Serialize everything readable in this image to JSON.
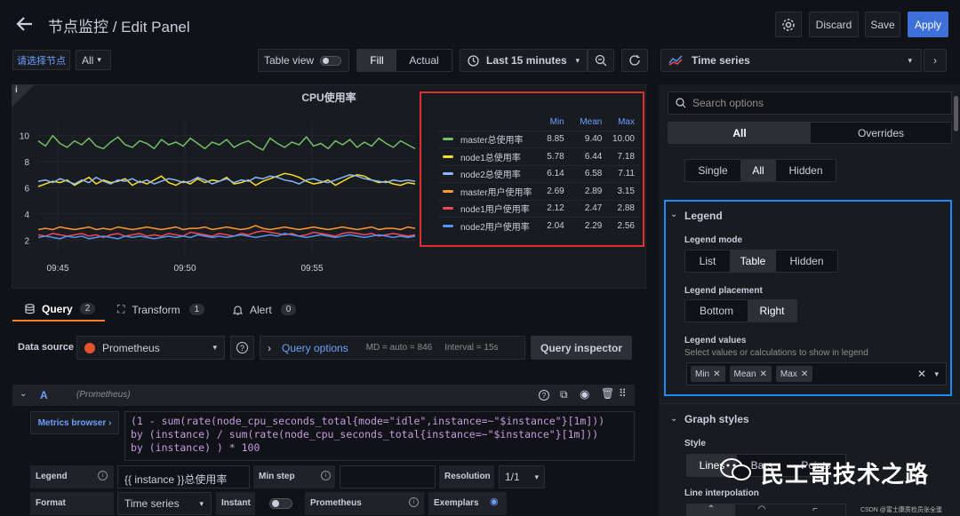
{
  "header": {
    "title": "节点监控 / Edit Panel",
    "discard": "Discard",
    "save": "Save",
    "apply": "Apply"
  },
  "toolbar": {
    "node_select": "请选择节点",
    "all": "All",
    "table_view": "Table view",
    "fill": "Fill",
    "actual": "Actual",
    "time_range": "Last 15 minutes",
    "viz": "Time series"
  },
  "chart_data": {
    "type": "line",
    "title": "CPU使用率",
    "x": [
      "09:45",
      "09:50",
      "09:55"
    ],
    "ylim": [
      1,
      11
    ],
    "yticks": [
      2,
      4,
      6,
      8,
      10
    ],
    "series": [
      {
        "name": "master总使用率",
        "color": "#73bf69",
        "min": "8.85",
        "mean": "9.40",
        "max": "10.00",
        "values": [
          9.6,
          9.2,
          10.0,
          9.4,
          9.1,
          9.6,
          9.3,
          9.8,
          9.2,
          9.0,
          9.5,
          9.9,
          9.3,
          9.1,
          9.6,
          9.4,
          9.0,
          9.7,
          9.3,
          9.5,
          9.2,
          9.8,
          9.4,
          9.0,
          9.5,
          9.3,
          9.7,
          9.1,
          9.4,
          9.6,
          9.2,
          8.9,
          9.8,
          9.4,
          9.1,
          9.5,
          9.3,
          9.9,
          9.2,
          9.4,
          9.0,
          9.6,
          9.3,
          9.7,
          9.1,
          9.5,
          9.2,
          9.8,
          9.4,
          9.1,
          9.6,
          9.3,
          9.0
        ]
      },
      {
        "name": "node1总使用率",
        "color": "#fade2a",
        "min": "5.78",
        "mean": "6.44",
        "max": "7.18",
        "values": [
          6.1,
          6.3,
          6.5,
          6.4,
          6.6,
          6.2,
          6.5,
          6.8,
          6.3,
          6.6,
          6.4,
          6.5,
          6.7,
          6.2,
          6.5,
          6.3,
          6.6,
          6.9,
          6.4,
          6.2,
          6.5,
          6.3,
          6.7,
          6.4,
          6.6,
          6.5,
          6.8,
          6.3,
          6.4,
          6.6,
          6.2,
          6.5,
          6.7,
          6.9,
          7.1,
          7.0,
          6.8,
          6.5,
          6.3,
          6.4,
          6.6,
          6.2,
          6.5,
          6.8,
          7.0,
          6.9,
          6.6,
          6.4,
          6.5,
          6.3,
          6.2,
          6.4,
          6.3
        ]
      },
      {
        "name": "node2总使用率",
        "color": "#8ab8ff",
        "min": "6.14",
        "mean": "6.58",
        "max": "7.11",
        "values": [
          6.5,
          6.6,
          6.4,
          6.7,
          6.5,
          6.3,
          6.6,
          6.4,
          6.8,
          6.5,
          6.3,
          6.6,
          6.5,
          6.7,
          6.4,
          6.6,
          6.3,
          6.5,
          6.7,
          6.6,
          6.4,
          6.5,
          6.8,
          6.6,
          6.3,
          6.5,
          6.7,
          6.4,
          6.6,
          6.5,
          6.8,
          6.7,
          6.9,
          6.8,
          6.6,
          6.5,
          6.3,
          6.6,
          6.7,
          6.5,
          6.4,
          6.6,
          6.8,
          7.0,
          6.9,
          6.7,
          6.6,
          6.5,
          6.4,
          6.6,
          6.5,
          6.6,
          6.5
        ]
      },
      {
        "name": "master用户使用率",
        "color": "#ff9830",
        "min": "2.69",
        "mean": "2.89",
        "max": "3.15",
        "values": [
          2.8,
          2.9,
          2.8,
          3.0,
          2.9,
          2.8,
          2.9,
          3.0,
          2.8,
          2.9,
          2.8,
          3.0,
          2.9,
          2.8,
          2.9,
          3.0,
          2.9,
          2.8,
          2.9,
          3.0,
          2.8,
          2.9,
          2.9,
          3.0,
          2.8,
          2.9,
          3.0,
          2.9,
          2.8,
          2.9,
          3.1,
          2.9,
          2.8,
          2.9,
          3.0,
          2.9,
          2.8,
          2.9,
          3.0,
          2.9,
          2.8,
          2.9,
          3.0,
          2.9,
          2.8,
          2.9,
          3.0,
          2.8,
          2.9,
          2.9,
          2.8,
          3.0,
          2.9
        ]
      },
      {
        "name": "node1用户使用率",
        "color": "#f2495c",
        "min": "2.12",
        "mean": "2.47",
        "max": "2.88",
        "values": [
          2.4,
          2.3,
          2.5,
          2.4,
          2.3,
          2.4,
          2.5,
          2.3,
          2.4,
          2.2,
          2.4,
          2.5,
          2.3,
          2.4,
          2.5,
          2.3,
          2.4,
          2.3,
          2.5,
          2.4,
          2.3,
          2.6,
          2.5,
          2.4,
          2.3,
          2.5,
          2.4,
          2.3,
          2.5,
          2.4,
          2.6,
          2.7,
          2.6,
          2.5,
          2.4,
          2.5,
          2.3,
          2.4,
          2.6,
          2.5,
          2.4,
          2.3,
          2.5,
          2.6,
          2.5,
          2.4,
          2.5,
          2.3,
          2.4,
          2.5,
          2.4,
          2.3,
          2.4
        ]
      },
      {
        "name": "node2用户使用率",
        "color": "#5794f2",
        "min": "2.04",
        "mean": "2.29",
        "max": "2.56",
        "values": [
          2.2,
          2.3,
          2.2,
          2.1,
          2.3,
          2.2,
          2.3,
          2.1,
          2.2,
          2.3,
          2.2,
          2.1,
          2.3,
          2.2,
          2.3,
          2.2,
          2.1,
          2.2,
          2.3,
          2.2,
          2.3,
          2.2,
          2.4,
          2.3,
          2.2,
          2.3,
          2.2,
          2.3,
          2.4,
          2.3,
          2.2,
          2.3,
          2.4,
          2.3,
          2.5,
          2.4,
          2.3,
          2.2,
          2.3,
          2.4,
          2.3,
          2.2,
          2.3,
          2.4,
          2.3,
          2.2,
          2.3,
          2.4,
          2.3,
          2.2,
          2.3,
          2.2,
          2.3
        ]
      }
    ],
    "legend": {
      "headers": [
        "Min",
        "Mean",
        "Max"
      ],
      "placement": "right"
    }
  },
  "tabs": [
    {
      "label": "Query",
      "count": "2"
    },
    {
      "label": "Transform",
      "count": "1"
    },
    {
      "label": "Alert",
      "count": "0"
    }
  ],
  "query": {
    "datasource_label": "Data source",
    "datasource": "Prometheus",
    "options": "Query options",
    "md": "MD = auto = 846",
    "interval": "Interval = 15s",
    "inspector": "Query inspector",
    "row_letter": "A",
    "row_ds": "(Prometheus)",
    "metrics_browser": "Metrics browser ›",
    "expr_line1": "(1 - sum(rate(node_cpu_seconds_total{mode=\"idle\",instance=~\"$instance\"}[1m]))",
    "expr_line2": "by (instance) / sum(rate(node_cpu_seconds_total{instance=~\"$instance\"}[1m]))",
    "expr_line3": "by (instance) ) * 100",
    "legend_label": "Legend",
    "legend_value": "{{ instance }}总使用率",
    "min_step": "Min step",
    "resolution": "Resolution",
    "resolution_value": "1/1",
    "format": "Format",
    "format_value": "Time series",
    "instant": "Instant",
    "prom": "Prometheus",
    "exemplars": "Exemplars"
  },
  "options": {
    "search_placeholder": "Search options",
    "all": "All",
    "overrides": "Overrides",
    "single": "Single",
    "all2": "All",
    "hidden": "Hidden",
    "legend_section": "Legend",
    "legend_mode": "Legend mode",
    "mode_list": "List",
    "mode_table": "Table",
    "mode_hidden": "Hidden",
    "legend_placement": "Legend placement",
    "bottom": "Bottom",
    "right": "Right",
    "legend_values": "Legend values",
    "legend_values_desc": "Select values or calculations to show in legend",
    "chip_min": "Min",
    "chip_mean": "Mean",
    "chip_max": "Max",
    "graph_styles": "Graph styles",
    "style": "Style",
    "style_line": "Lines",
    "style_bars": "Bars",
    "style_points": "Points",
    "line_interp": "Line interpolation"
  },
  "watermark": {
    "brand": "民工哥技术之路",
    "credit": "CSDN @富士康质检员张全蛋"
  }
}
